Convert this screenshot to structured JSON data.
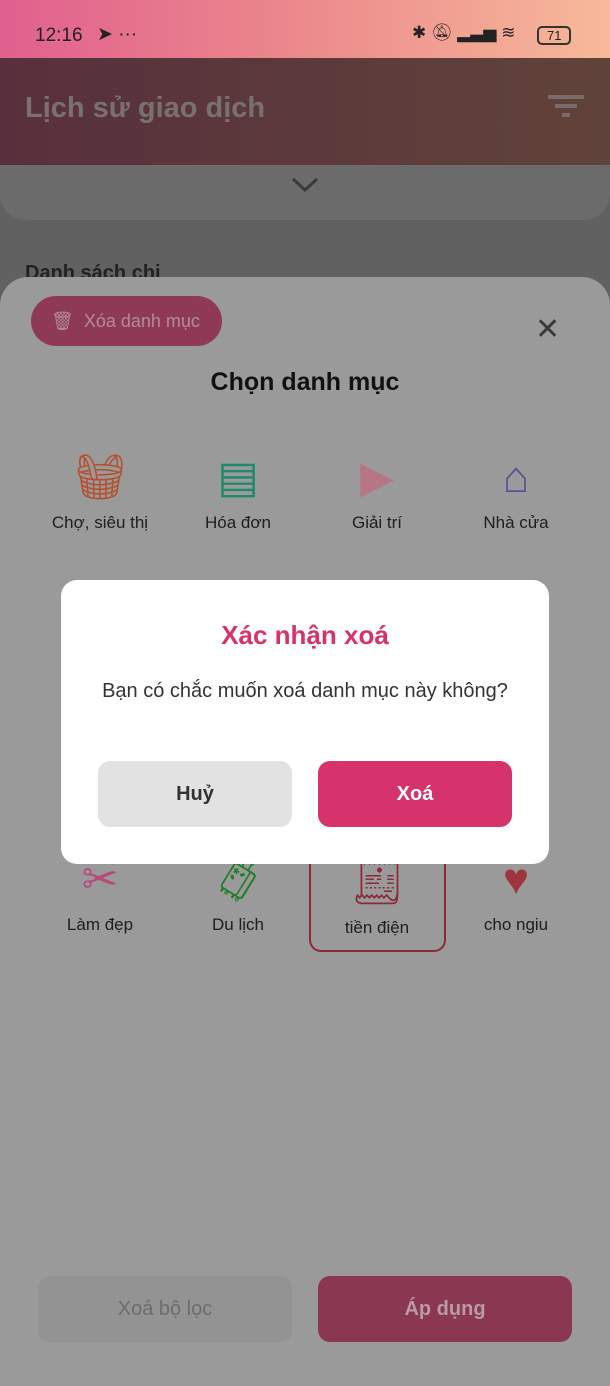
{
  "status_bar": {
    "time": "12:16",
    "battery": "71"
  },
  "header": {
    "title": "Lịch sử giao dịch"
  },
  "background": {
    "list_label": "Danh sách chi"
  },
  "sheet": {
    "delete_category_label": "Xóa danh mục",
    "title": "Chọn danh mục",
    "categories": [
      {
        "label": "Chợ, siêu thị",
        "icon": "basket-icon",
        "color": "#b5502f"
      },
      {
        "label": "Hóa đơn",
        "icon": "document-icon",
        "color": "#1e8a6a"
      },
      {
        "label": "Giải trí",
        "icon": "play-icon",
        "color": "#b77685"
      },
      {
        "label": "Nhà cửa",
        "icon": "house-icon",
        "color": "#5e4f9a"
      },
      {
        "label": "Làm đẹp",
        "icon": "scissors-icon",
        "color": "#b84a7a"
      },
      {
        "label": "Du lịch",
        "icon": "luggage-icon",
        "color": "#1f7a2a"
      },
      {
        "label": "tiền điện",
        "icon": "receipt-icon",
        "color": "#8b2a37",
        "selected": true
      },
      {
        "label": "cho ngiu",
        "icon": "heart-icon",
        "color": "#a0343e"
      }
    ],
    "clear_filter_label": "Xoá bộ lọc",
    "apply_label": "Áp dụng"
  },
  "dialog": {
    "title": "Xác nhận xoá",
    "message": "Bạn có chắc muốn xoá danh mục này không?",
    "cancel_label": "Huỷ",
    "confirm_label": "Xoá"
  }
}
